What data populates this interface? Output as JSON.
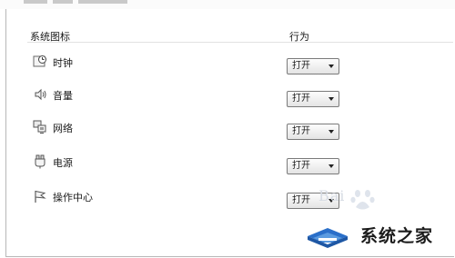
{
  "header": {
    "col_icon": "系统图标",
    "col_behavior": "行为"
  },
  "rows": [
    {
      "label": "时钟",
      "value": "打开",
      "icon": "clock-icon"
    },
    {
      "label": "音量",
      "value": "打开",
      "icon": "speaker-icon"
    },
    {
      "label": "网络",
      "value": "打开",
      "icon": "network-icon"
    },
    {
      "label": "电源",
      "value": "打开",
      "icon": "power-icon"
    },
    {
      "label": "操作中心",
      "value": "打开",
      "icon": "flag-icon"
    }
  ],
  "watermark": {
    "faint": "Bai",
    "text": "系统之家"
  },
  "colors": {
    "accent_blue": "#1e63b8",
    "border": "#b8b8b8"
  }
}
